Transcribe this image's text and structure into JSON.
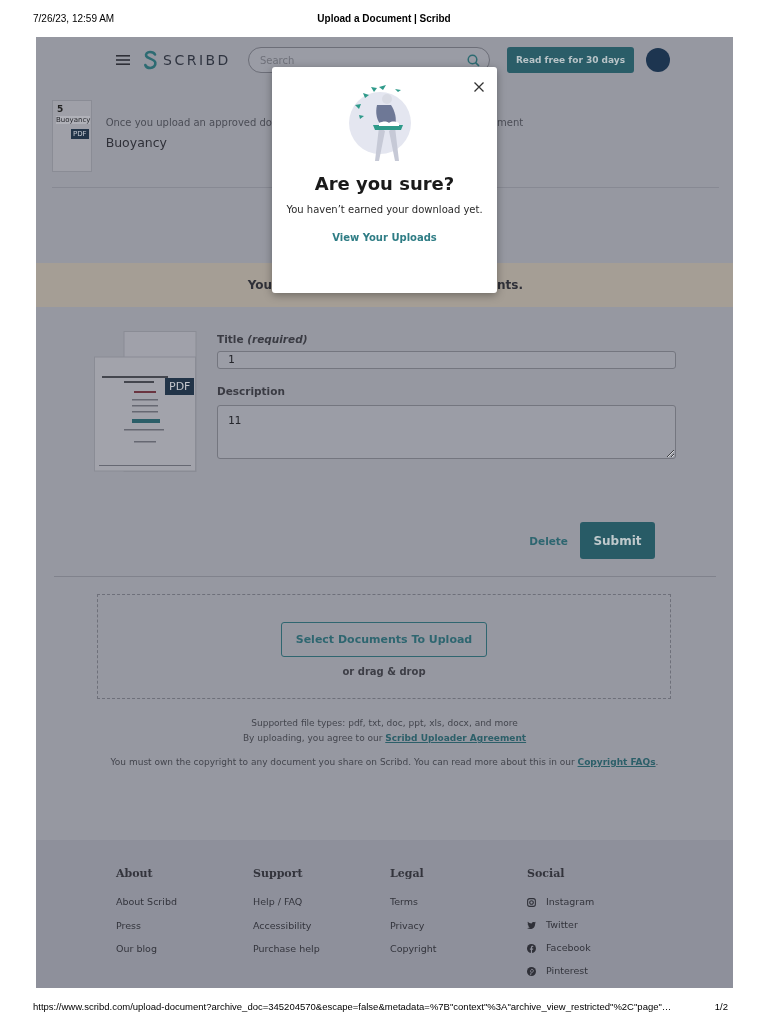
{
  "print_header": {
    "date": "7/26/23, 12:59 AM",
    "title": "Upload a Document | Scribd"
  },
  "nav": {
    "logo": "SCRIBD",
    "search": {
      "placeholder": "Search"
    },
    "cta": "Read free for 30 days"
  },
  "uploaded_doc": {
    "thumb_number": "5",
    "thumb_title": "Buoyancy",
    "badge": "PDF",
    "notice_start": "Once you upload an approved do",
    "notice_end": "ment",
    "title": "Buoyancy"
  },
  "banner": {
    "text_start": "You",
    "text_end": "nts."
  },
  "form": {
    "thumb_badge": "PDF",
    "title_label": "Title *(required)*",
    "title_value": "1",
    "description_label": "Description",
    "description_value": "11",
    "delete": "Delete",
    "submit": "Submit"
  },
  "dropzone": {
    "button": "Select Documents To Upload",
    "hint": "or drag & drop"
  },
  "info": {
    "file_types": "Supported file types: pdf, txt, doc, ppt, xls, docx, and more",
    "agree_text": "By uploading, you agree to our ",
    "agree_link": "Scribd Uploader Agreement",
    "copyright_text": "You must own the copyright to any document you share on Scribd. You can read more about this in our ",
    "copyright_link": "Copyright FAQs",
    "copyright_end": "."
  },
  "footer": {
    "columns": [
      {
        "heading": "About",
        "links": [
          {
            "label": "About Scribd"
          },
          {
            "label": "Press"
          },
          {
            "label": "Our blog"
          }
        ]
      },
      {
        "heading": "Support",
        "links": [
          {
            "label": "Help / FAQ"
          },
          {
            "label": "Accessibility"
          },
          {
            "label": "Purchase help"
          }
        ]
      },
      {
        "heading": "Legal",
        "links": [
          {
            "label": "Terms"
          },
          {
            "label": "Privacy"
          },
          {
            "label": "Copyright"
          }
        ]
      },
      {
        "heading": "Social",
        "links": [
          {
            "label": "Instagram",
            "kind": "instagram"
          },
          {
            "label": "Twitter",
            "kind": "twitter"
          },
          {
            "label": "Facebook",
            "kind": "facebook"
          },
          {
            "label": "Pinterest",
            "kind": "pinterest"
          }
        ]
      }
    ]
  },
  "modal": {
    "title": "Are you sure?",
    "message": "You haven’t earned your download yet.",
    "link": "View Your Uploads"
  },
  "print_footer": {
    "url": "https://www.scribd.com/upload-document?archive_doc=345204570&escape=false&metadata=%7B\"context\"%3A\"archive_view_restricted\"%2C\"page\"…",
    "page": "1/2"
  }
}
